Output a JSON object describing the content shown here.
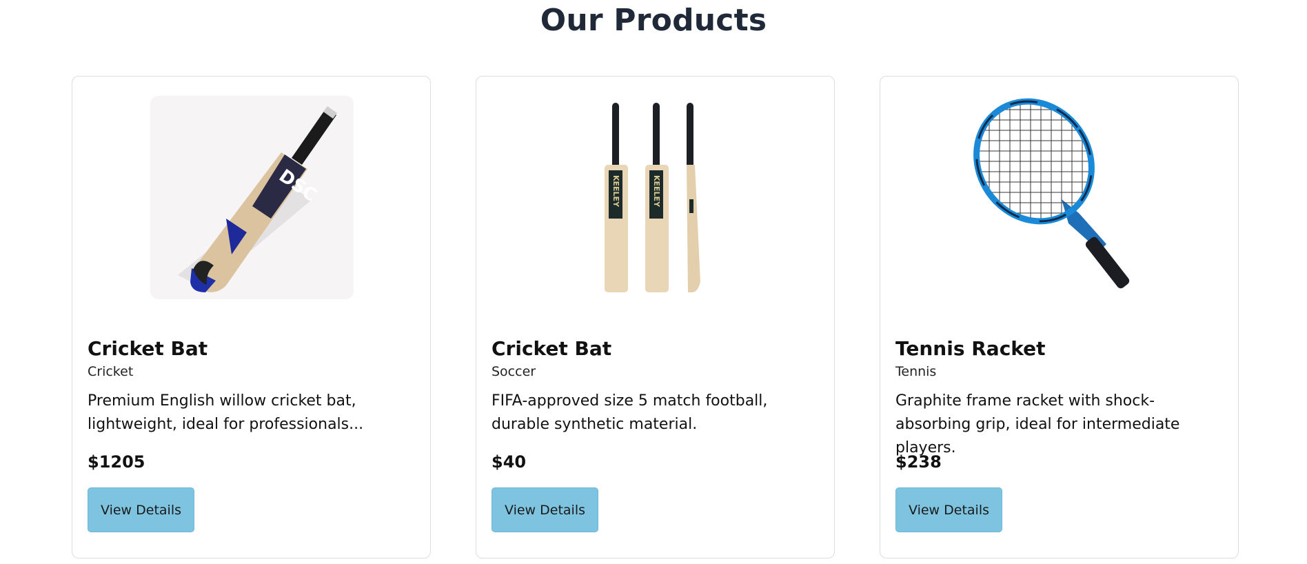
{
  "page": {
    "title": "Our Products"
  },
  "products": [
    {
      "name": "Cricket Bat",
      "category": "Cricket",
      "description": "Premium English willow cricket bat, lightweight, ideal for professionals...",
      "price": "$1205",
      "button_label": "View Details"
    },
    {
      "name": "Cricket Bat",
      "category": "Soccer",
      "description": "FIFA-approved size 5 match football, durable synthetic material.",
      "price": "$40",
      "button_label": "View Details"
    },
    {
      "name": "Tennis Racket",
      "category": "Tennis",
      "description": "Graphite frame racket with shock-absorbing grip, ideal for intermediate players.",
      "price": "$238",
      "button_label": "View Details"
    }
  ],
  "colors": {
    "button_bg": "#7ec4e0",
    "title": "#1f2937",
    "card_border": "#d9dde2"
  }
}
